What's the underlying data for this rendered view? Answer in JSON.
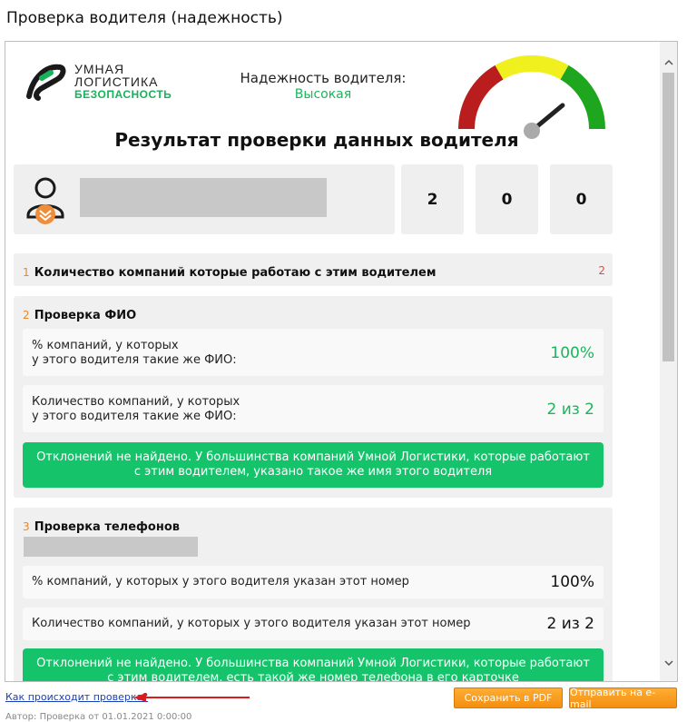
{
  "window": {
    "title": "Проверка водителя (надежность)"
  },
  "logo": {
    "line1": "УМНАЯ",
    "line2": "ЛОГИСТИКА",
    "line3": "БЕЗОПАСНОСТЬ"
  },
  "reliability": {
    "label": "Надежность водителя:",
    "value": "Высокая",
    "level_fraction": 0.78
  },
  "colors": {
    "accent_green": "#1bb55c",
    "alert_green": "#15c36b",
    "gauge_red": "#b91d1d",
    "gauge_yellow": "#f0f01e",
    "gauge_green": "#1ea61e",
    "accent_orange": "#e6872d",
    "count_red": "#e24a4a",
    "button_orange": "#f7a22a"
  },
  "main_title": "Результат проверки данных водителя",
  "stats": [
    "2",
    "0",
    "0"
  ],
  "sections": {
    "companies": {
      "num": "1",
      "title": "Количество компаний которые работаю с этим водителем",
      "count": "2"
    },
    "fio": {
      "num": "2",
      "title": "Проверка ФИО",
      "rows": [
        {
          "label_line1": "% компаний, у которых",
          "label_line2": "у этого водителя такие же ФИО:",
          "value": "100%"
        },
        {
          "label_line1": "Количество компаний, у которых",
          "label_line2": "у этого водителя такие же ФИО:",
          "value": "2 из 2"
        }
      ],
      "alert_line1": "Отклонений не найдено. У большинства компаний Умной Логистики, которые работают",
      "alert_line2": "с этим водителем, указано такое же имя этого водителя"
    },
    "phones": {
      "num": "3",
      "title": "Проверка телефонов",
      "rows": [
        {
          "label": "% компаний, у которых у этого водителя указан этот номер",
          "value": "100%"
        },
        {
          "label": "Количество компаний, у которых у этого водителя указан этот номер",
          "value": "2 из 2"
        }
      ],
      "alert_line1": "Отклонений не найдено. У большинства компаний Умной Логистики, которые работают",
      "alert_line2": "с этим водителем, есть такой же номер телефона в его карточке"
    }
  },
  "footer": {
    "how_link": "Как происходит проверка?",
    "save_pdf": "Сохранить в PDF",
    "send_email": "Отправить на e-mail",
    "cutoff_text": "Автор: Проверка от 01.01.2021 0:00:00"
  },
  "icons": [
    "logo-mark-icon",
    "person-icon",
    "chevron-badge-icon",
    "gauge-needle-icon",
    "scroll-up-icon",
    "scroll-down-icon",
    "red-arrow-icon"
  ]
}
